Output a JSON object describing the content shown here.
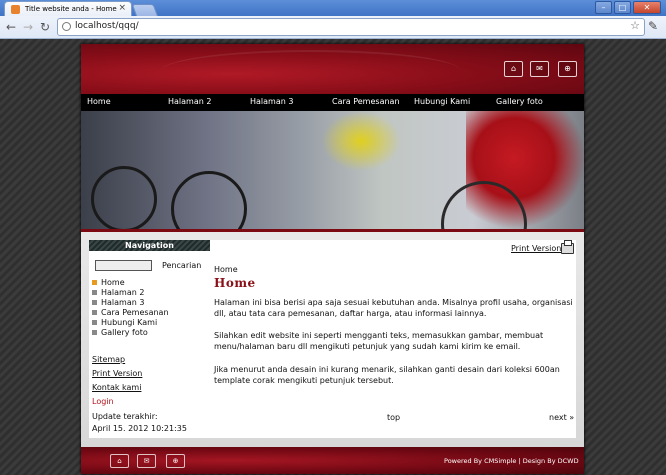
{
  "browser": {
    "tab_title": "Title website anda - Home",
    "tab_close": "×",
    "url": "localhost/qqq/",
    "window_controls": {
      "minimize": "–",
      "maximize": "□",
      "close": "✕"
    },
    "nav_icons": {
      "back": "←",
      "forward": "→",
      "reload": "↻",
      "star": "☆",
      "wrench": "🔧"
    }
  },
  "header": {
    "icons": [
      "home-icon",
      "mail-icon",
      "sitemap-icon"
    ],
    "icon_glyphs": {
      "home": "⌂",
      "mail": "✉",
      "sitemap": "⊕"
    }
  },
  "menu": {
    "items": [
      "Home",
      "Halaman 2",
      "Halaman 3",
      "Cara Pemesanan",
      "Hubungi Kami",
      "Gallery foto"
    ]
  },
  "sidebar": {
    "title": "Navigation",
    "search_button": "Pencarian",
    "nav_items": [
      "Home",
      "Halaman 2",
      "Halaman 3",
      "Cara Pemesanan",
      "Hubungi Kami",
      "Gallery foto"
    ],
    "links": [
      "Sitemap",
      "Print Version",
      "Kontak kami"
    ],
    "login": "Login",
    "update_label": "Update terakhir:",
    "update_value": "April 15. 2012 10:21:35"
  },
  "main": {
    "print_version": "Print Version",
    "breadcrumb": "Home",
    "heading": "Home",
    "para1": "Halaman ini bisa berisi apa saja sesuai kebutuhan anda. Misalnya profil usaha, organisasi dll, atau tata cara pemesanan, daftar harga, atau informasi lainnya.",
    "para2": "Silahkan edit website ini seperti mengganti teks, memasukkan gambar, membuat menu/halaman baru dll mengikuti petunjuk yang sudah kami kirim ke email.",
    "para3": "Jika menurut anda desain ini kurang menarik, silahkan ganti desain dari koleksi 600an template corak mengikuti petunjuk tersebut.",
    "top_link": "top",
    "next_link": "next »"
  },
  "footer": {
    "credits": "Powered By CMSimple | Design By DCWD"
  },
  "colors": {
    "brand_red": "#8a0e19",
    "accent_orange": "#e79a20",
    "heading_red": "#8a1018"
  }
}
